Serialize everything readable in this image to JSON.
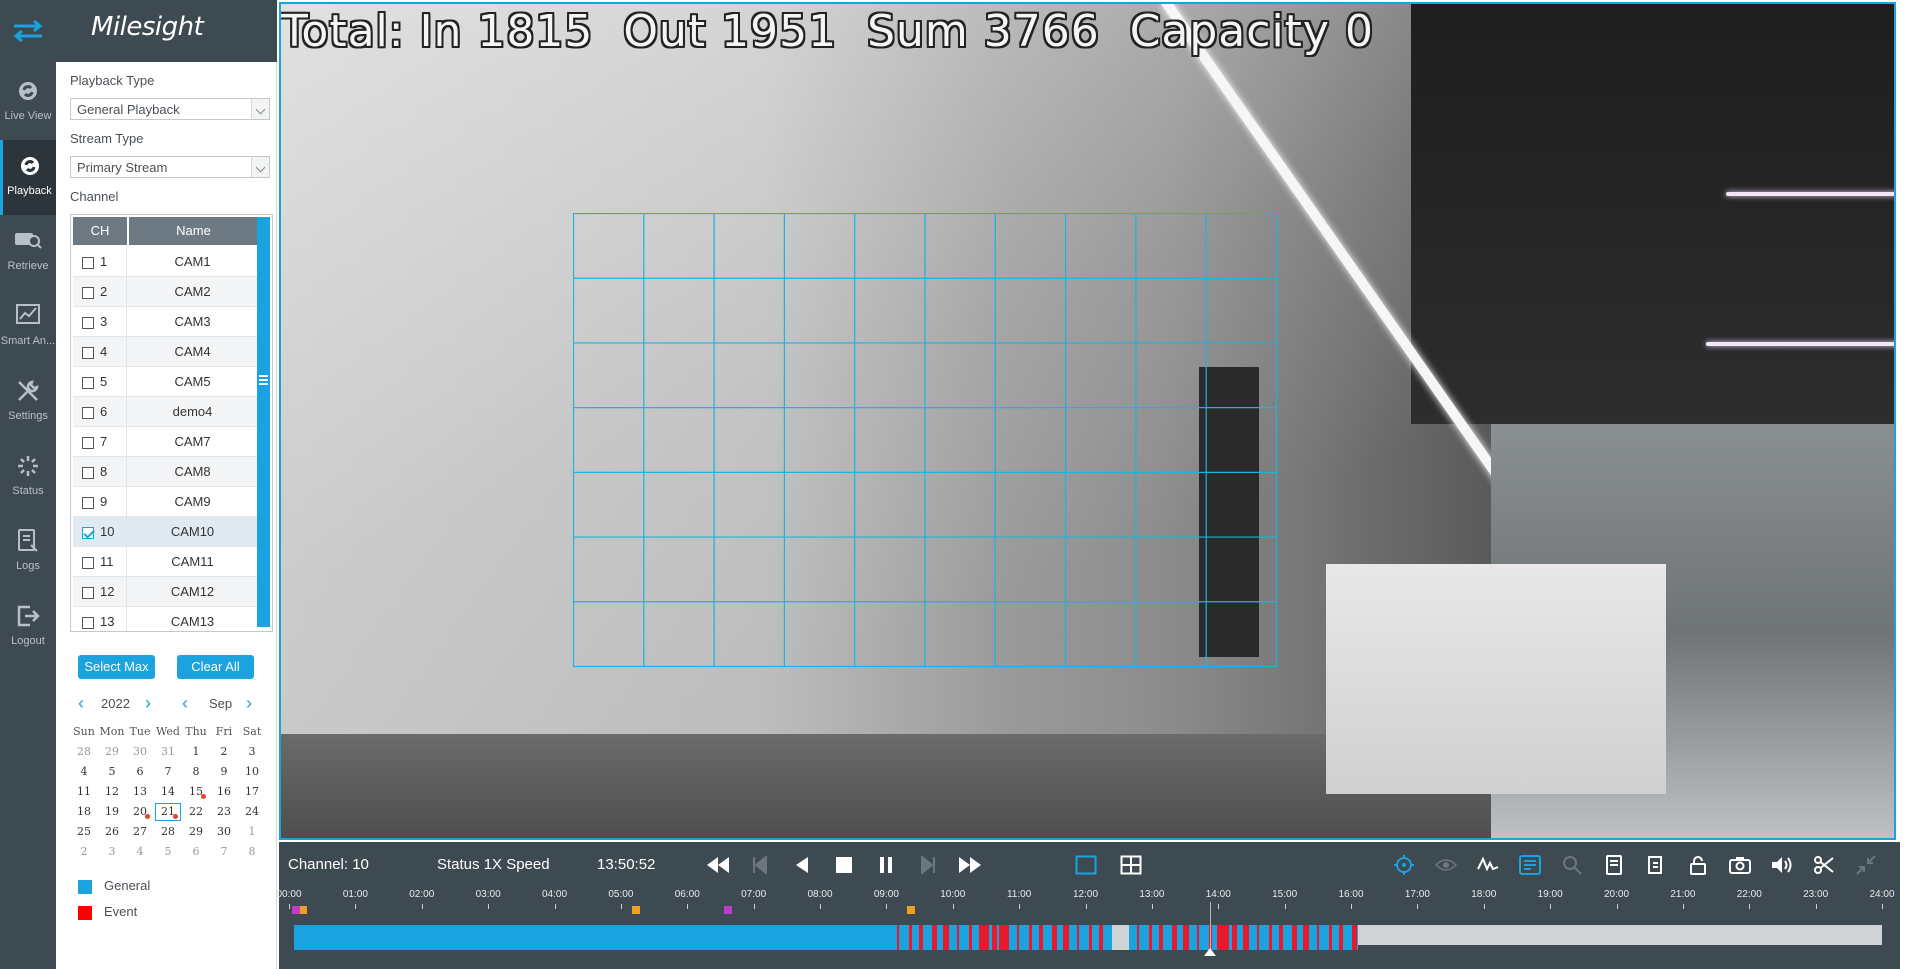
{
  "nav": {
    "items": [
      {
        "label": "Live View",
        "icon": "live-view-icon"
      },
      {
        "label": "Playback",
        "icon": "playback-icon"
      },
      {
        "label": "Retrieve",
        "icon": "retrieve-icon"
      },
      {
        "label": "Smart An...",
        "icon": "smart-analytics-icon"
      },
      {
        "label": "Settings",
        "icon": "settings-icon"
      },
      {
        "label": "Status",
        "icon": "status-icon"
      },
      {
        "label": "Logs",
        "icon": "logs-icon"
      },
      {
        "label": "Logout",
        "icon": "logout-icon"
      }
    ],
    "active": "Playback"
  },
  "brand": {
    "logo": "Milesight"
  },
  "panel": {
    "playback_type_label": "Playback Type",
    "playback_type_value": "General Playback",
    "stream_type_label": "Stream Type",
    "stream_type_value": "Primary Stream",
    "channel_label": "Channel",
    "table_headers": {
      "ch": "CH",
      "name": "Name"
    },
    "channels": [
      {
        "ch": "1",
        "name": "CAM1",
        "checked": false
      },
      {
        "ch": "2",
        "name": "CAM2",
        "checked": false
      },
      {
        "ch": "3",
        "name": "CAM3",
        "checked": false
      },
      {
        "ch": "4",
        "name": "CAM4",
        "checked": false
      },
      {
        "ch": "5",
        "name": "CAM5",
        "checked": false
      },
      {
        "ch": "6",
        "name": "demo4",
        "checked": false
      },
      {
        "ch": "7",
        "name": "CAM7",
        "checked": false
      },
      {
        "ch": "8",
        "name": "CAM8",
        "checked": false
      },
      {
        "ch": "9",
        "name": "CAM9",
        "checked": false
      },
      {
        "ch": "10",
        "name": "CAM10",
        "checked": true
      },
      {
        "ch": "11",
        "name": "CAM11",
        "checked": false
      },
      {
        "ch": "12",
        "name": "CAM12",
        "checked": false
      },
      {
        "ch": "13",
        "name": "CAM13",
        "checked": false
      }
    ],
    "select_max": "Select Max",
    "clear_all": "Clear All"
  },
  "calendar": {
    "year": "2022",
    "month": "Sep",
    "weekdays": [
      "Sun",
      "Mon",
      "Tue",
      "Wed",
      "Thu",
      "Fri",
      "Sat"
    ],
    "weeks": [
      [
        "28",
        "29",
        "30",
        "31",
        "1",
        "2",
        "3"
      ],
      [
        "4",
        "5",
        "6",
        "7",
        "8",
        "9",
        "10"
      ],
      [
        "11",
        "12",
        "13",
        "14",
        "15",
        "16",
        "17"
      ],
      [
        "18",
        "19",
        "20",
        "21",
        "22",
        "23",
        "24"
      ],
      [
        "25",
        "26",
        "27",
        "28",
        "29",
        "30",
        "1"
      ],
      [
        "2",
        "3",
        "4",
        "5",
        "6",
        "7",
        "8"
      ]
    ],
    "outside_month": {
      "0": [
        0,
        1,
        2,
        3
      ],
      "4": [
        6
      ],
      "5": [
        0,
        1,
        2,
        3,
        4,
        5,
        6
      ]
    },
    "marked_days": [
      "15",
      "20",
      "21"
    ],
    "selected_day": "21",
    "legend": [
      {
        "label": "General",
        "color": "#1aa3df"
      },
      {
        "label": "Event",
        "color": "#ff0000"
      }
    ]
  },
  "video": {
    "overlay": "Total: In 1815  Out 1951  Sum 3766  Capacity 0",
    "grid_color": "#1ab4e0",
    "grid_cols": 10,
    "grid_rows": 7
  },
  "playback": {
    "channel": "Channel: 10",
    "status": "Status 1X Speed",
    "time": "13:50:52",
    "hours": [
      "00:00",
      "01:00",
      "02:00",
      "03:00",
      "04:00",
      "05:00",
      "06:00",
      "07:00",
      "08:00",
      "09:00",
      "10:00",
      "11:00",
      "12:00",
      "13:00",
      "14:00",
      "15:00",
      "16:00",
      "17:00",
      "18:00",
      "19:00",
      "20:00",
      "21:00",
      "22:00",
      "23:00",
      "24:00"
    ],
    "current_time_fraction": 0.577,
    "record_end_fraction": 0.67,
    "colors": {
      "general": "#1aa3df",
      "event": "#e8192c",
      "empty": "#cfd3d5",
      "lock": "#f0a020",
      "tag": "#c03cc8"
    }
  }
}
